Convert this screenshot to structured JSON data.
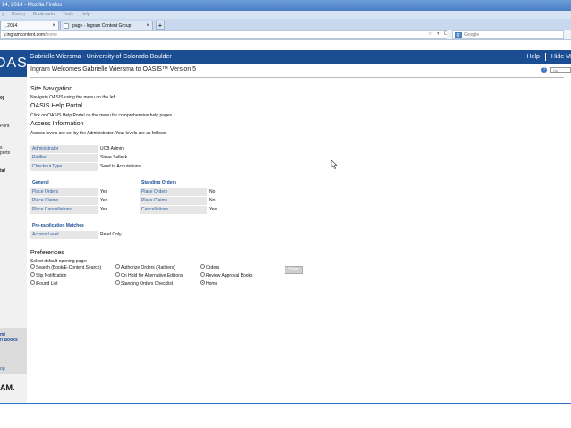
{
  "window": {
    "title": "14, 2014 - Mozilla Firefox"
  },
  "menubar": {
    "items": [
      "y",
      "History",
      "Bookmarks",
      "Tools",
      "Help"
    ]
  },
  "tabs": [
    {
      "label": "., 2014",
      "close": "×"
    },
    {
      "label": "ipage - Ingram Content Group",
      "close": "×"
    }
  ],
  "new_tab": "+",
  "address_bar": {
    "host": "y.ingramcontent.com",
    "path": "/home"
  },
  "nav_icons": {
    "star": "☆",
    "dropdown": "▾",
    "reload": "C"
  },
  "search": {
    "engine": "g",
    "placeholder": "Google"
  },
  "sidebar": {
    "logo": "OASIS",
    "items": [
      "0)",
      "Print",
      "s",
      "ports",
      "tal"
    ],
    "grey_block": [
      "mi",
      "n Books",
      "og"
    ],
    "bottom_logo": "AM."
  },
  "header": {
    "user": "Gabrielle Wiersma - University of Colorado Boulder",
    "help": "Help",
    "hide": "Hide M"
  },
  "welcome": "Ingram Welcomes Gabrielle Wiersma to OASIS™ Version 5",
  "help_icon": "?",
  "quick_search_placeholder": "Qui",
  "site_navigation": {
    "heading": "Site Navigation",
    "text": "Navigate OASIS using the menu on the left."
  },
  "help_portal": {
    "heading": "OASIS Help Portal",
    "text": "Click on OASIS Help Portal on the menu for comprehensive help pages."
  },
  "access": {
    "heading": "Access Information",
    "text": "Access levels are set by the Administrator. Your levels are as follows:",
    "rows": [
      {
        "label": "Administrator",
        "value": "UCB Admin"
      },
      {
        "label": "Ratifier",
        "value": "Steve Selleck"
      },
      {
        "label": "Checkout Type",
        "value": "Send to Acquisitions"
      }
    ],
    "general": {
      "header": "General",
      "rows": [
        {
          "label": "Place Orders",
          "value": "Yes"
        },
        {
          "label": "Place Claims",
          "value": "Yes"
        },
        {
          "label": "Place Cancellations",
          "value": "Yes"
        }
      ]
    },
    "standing": {
      "header": "Standing Orders",
      "rows": [
        {
          "label": "Place Orders",
          "value": "No"
        },
        {
          "label": "Place Claims",
          "value": "No"
        },
        {
          "label": "Cancellations",
          "value": "Yes"
        }
      ]
    },
    "prepub": {
      "header": "Pre-publication Matches",
      "rows": [
        {
          "label": "Access Level",
          "value": "Read Only"
        }
      ]
    }
  },
  "preferences": {
    "heading": "Preferences",
    "text": "Select default opening page:",
    "options": [
      {
        "label": "Search (Book/E-Content Search)",
        "checked": false
      },
      {
        "label": "Slip Notification",
        "checked": false
      },
      {
        "label": "iFound List",
        "checked": false
      },
      {
        "label": "Authorize Orders (Ratifiers)",
        "checked": false
      },
      {
        "label": "On Hold for Alternative Editions",
        "checked": false
      },
      {
        "label": "Standing Orders Checklist",
        "checked": false
      },
      {
        "label": "Orders",
        "checked": false
      },
      {
        "label": "Review Approval Books",
        "checked": false
      },
      {
        "label": "Home",
        "checked": true
      }
    ],
    "save_label": "Save"
  },
  "colors": {
    "brand_blue": "#1b4d93",
    "link_blue": "#2f61a8",
    "cell_grey": "#e6e6e6"
  }
}
